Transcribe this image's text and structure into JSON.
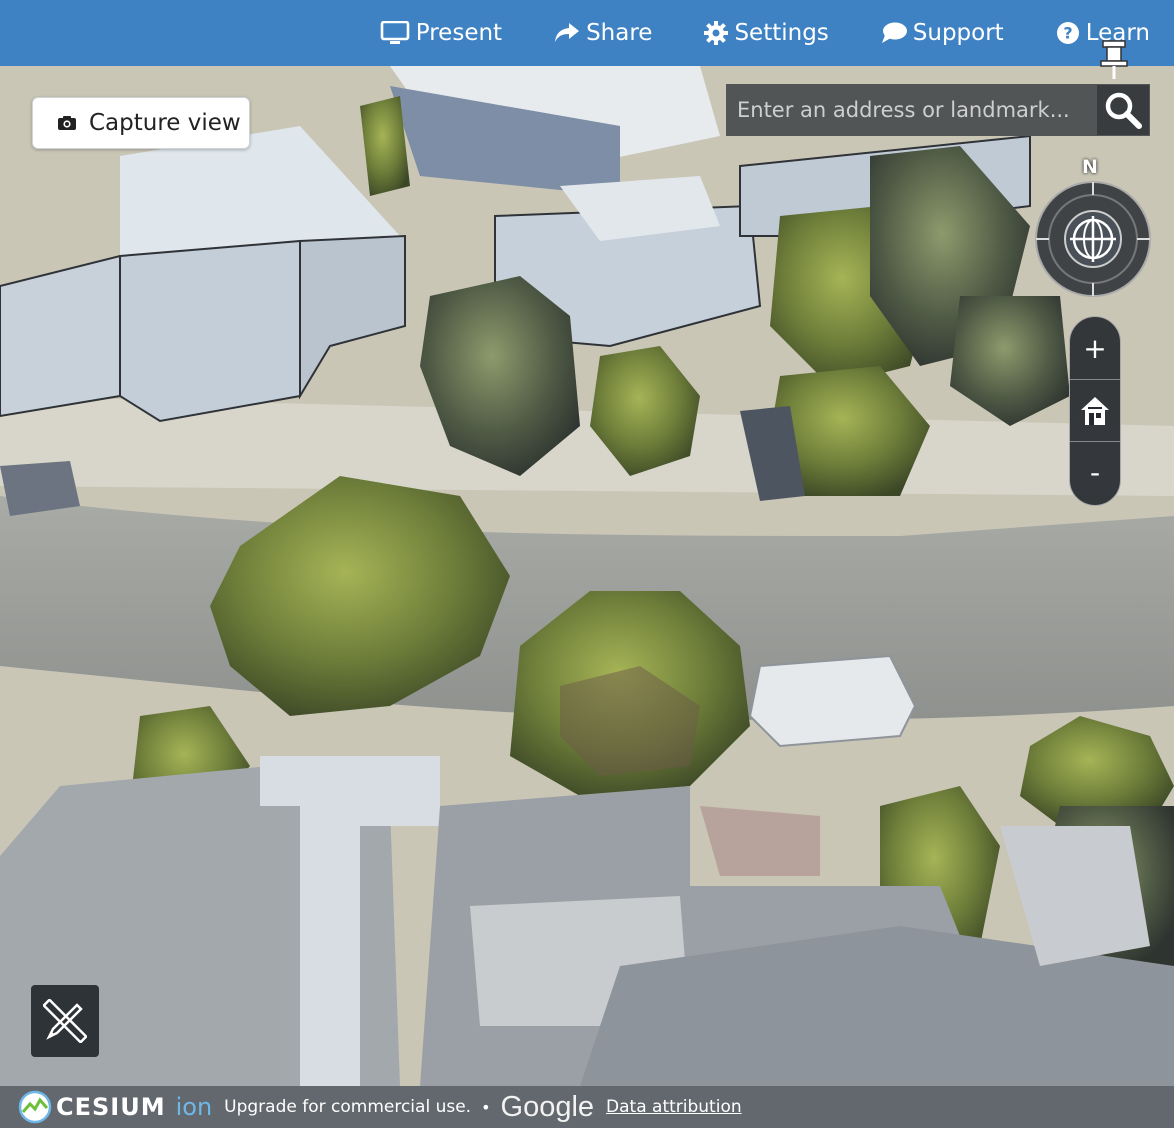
{
  "topnav": {
    "present": "Present",
    "share": "Share",
    "settings": "Settings",
    "support": "Support",
    "learn": "Learn"
  },
  "capture": {
    "label": "Capture view"
  },
  "search": {
    "placeholder": "Enter an address or landmark..."
  },
  "compass": {
    "north_label": "N"
  },
  "zoom": {
    "in": "+",
    "out": "-"
  },
  "footer": {
    "cesium": "CESIUM",
    "ion": "ion",
    "upgrade": "Upgrade for commercial use.",
    "separator": "•",
    "google": "Google",
    "attribution": "Data attribution"
  },
  "colors": {
    "topbar": "#3f82c4",
    "accent": "#6fb7e6"
  }
}
